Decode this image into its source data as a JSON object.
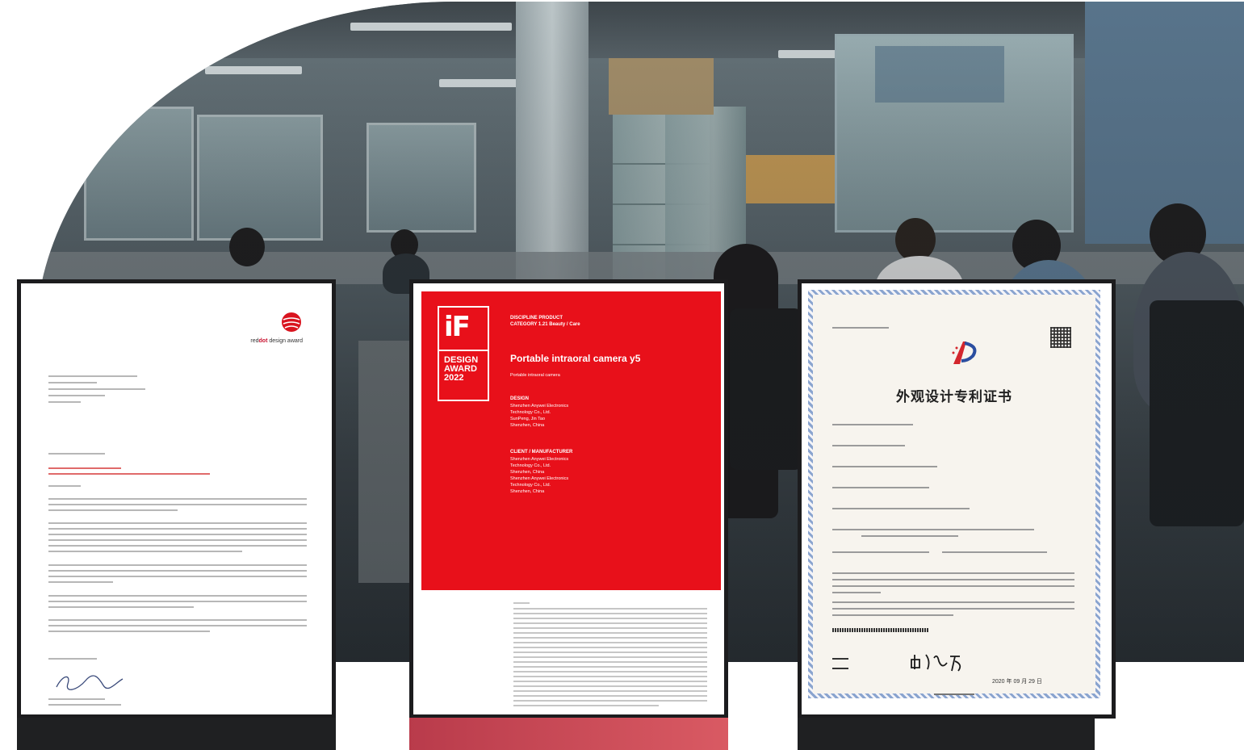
{
  "cards": {
    "red_dot": {
      "brand_prefix": "red",
      "brand_mid": "dot",
      "brand_suffix": " design award"
    },
    "if_award": {
      "logo_letters": "iF",
      "logo_text": "DESIGN\nAWARD\n2022",
      "discipline": "DISCIPLINE PRODUCT",
      "category": "CATEGORY 1.21 Beauty / Care",
      "product_title": "Portable intraoral camera y5",
      "product_subtitle": "Portable intraoral camera",
      "design_heading": "DESIGN",
      "design_lines": [
        "Shenzhen Anywei Electronics",
        "Technology Co., Ltd.",
        "SunPeng, Jin Tao",
        "Shenzhen, China"
      ],
      "client_heading": "CLIENT / MANUFACTURER",
      "client_lines": [
        "Shenzhen Anywei Electronics",
        "Technology Co., Ltd.",
        "Shenzhen, China",
        "Shenzhen Anywei Electronics",
        "Technology Co., Ltd.",
        "Shenzhen, China"
      ]
    },
    "patent": {
      "title": "外观设计专利证书",
      "date": "2020 年 09 月 29 日"
    }
  },
  "colors": {
    "card_footer_dark": "#1f2022",
    "card_footer_red_start": "#b93b4b",
    "card_footer_red_end": "#d95a63",
    "if_red": "#e8101a"
  }
}
